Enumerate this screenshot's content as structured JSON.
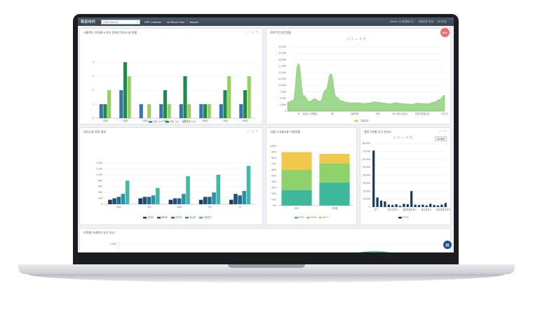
{
  "topbar": {
    "logo": "하모아키",
    "search_placeholder": "Data Board",
    "nav": [
      "APP Creation",
      "All Block Size",
      "Report"
    ],
    "user": "Admin 님 환영합니다.",
    "links": [
      "비밀번호 변경",
      "로그아웃"
    ]
  },
  "all_button": "ALL",
  "panels": {
    "p1": {
      "title": "서울북도 자치별 노약자 장애인 편의시설 현황"
    },
    "p2": {
      "title": "2017년 방문생활"
    },
    "p3": {
      "title": "대기오염 측정 결과"
    },
    "p4": {
      "title": "서울시 대표교통 이용현황"
    },
    "p5": {
      "title": "행정구역별 인구 분포도",
      "year": "2018년"
    },
    "p6": {
      "title": "지역별 미세먼지 농도 비교"
    }
  },
  "colors": {
    "blue": "#3b74ad",
    "dark_green": "#1f8a4c",
    "light_green": "#95d160",
    "area_green": "#8fd07a",
    "navy": "#1c3a5c",
    "yellow": "#f0c94c",
    "teal": "#3fb79b"
  },
  "chart_data": [
    {
      "type": "bar",
      "categories": [
        "1층안",
        "2층안",
        "3층안",
        "4층안",
        "5층안",
        "6층안",
        "7층안",
        "8층안"
      ],
      "series": [
        {
          "name": "유형 1(1)",
          "values": [
            1,
            2,
            1,
            1,
            1,
            1,
            1,
            1
          ]
        },
        {
          "name": "유형 1(2)",
          "values": [
            1,
            4,
            0,
            2,
            3,
            1,
            2,
            2
          ]
        },
        {
          "name": "유형 1(3)",
          "values": [
            2,
            3,
            1,
            1,
            1,
            1,
            3,
            3
          ]
        }
      ],
      "ylim": [
        0,
        4
      ],
      "yticks": [
        "0",
        "1",
        "2",
        "3",
        "4"
      ]
    },
    {
      "type": "area",
      "x": [
        "",
        "허",
        "양남지 1에점방",
        "",
        "해",
        "",
        "계대약부",
        "",
        "고령",
        "",
        "도도 종도신장대",
        "",
        "보호지전통식당",
        "",
        "기타 신"
      ],
      "values": [
        3500,
        4200,
        18500,
        6000,
        3800,
        4800,
        3900,
        8200,
        14500,
        5500,
        4000,
        3400,
        3200,
        3300,
        3000,
        3200,
        3600,
        3400,
        3100,
        2900,
        3300,
        3000,
        2800,
        2700,
        3100,
        3000,
        2900,
        3500,
        4500,
        6200
      ],
      "ylim": [
        0,
        25000
      ],
      "yticks": [
        "0",
        "2,500",
        "5,000",
        "7,500",
        "10,000",
        "12,500",
        "15,000",
        "17,500",
        "20,000",
        "22,500",
        "25,000"
      ],
      "legend": "월별주요"
    },
    {
      "type": "bar",
      "categories": [
        "Mon",
        "Tue",
        "Wed",
        "Thu",
        "Fri"
      ],
      "series": [
        {
          "name": "강원계",
          "values": [
            150,
            200,
            150,
            150,
            150
          ]
        },
        {
          "name": "충청계",
          "values": [
            200,
            250,
            200,
            250,
            350
          ]
        },
        {
          "name": "전라계",
          "values": [
            250,
            250,
            200,
            250,
            300
          ]
        },
        {
          "name": "경상계",
          "values": [
            350,
            300,
            350,
            400,
            450
          ]
        },
        {
          "name": "서울경기",
          "values": [
            800,
            550,
            950,
            1000,
            1300
          ]
        }
      ],
      "ylim": [
        0,
        1400
      ],
      "yticks": [
        "0",
        "200",
        "400",
        "600",
        "800",
        "1,000",
        "1,200",
        "1,400"
      ]
    },
    {
      "type": "bar",
      "categories": [
        "버스",
        "지하철"
      ],
      "series": [
        {
          "name": "2015",
          "values": [
            26,
            39
          ]
        },
        {
          "name": "2016",
          "values": [
            34,
            32
          ]
        },
        {
          "name": "2017",
          "values": [
            30,
            16
          ]
        }
      ],
      "ylim": [
        0,
        100
      ],
      "yticks": [
        "0%",
        "10%",
        "20%",
        "30%",
        "40%",
        "50%",
        "60%",
        "70%",
        "80%",
        "90%",
        "100%"
      ]
    },
    {
      "type": "bar",
      "categories": [
        "인구",
        "",
        "인천 광역시",
        "",
        "세종특별자치시",
        "",
        "울산광역시",
        "",
        "제주특별자치도"
      ],
      "values": [
        71000,
        12000,
        8000,
        7000,
        3000,
        2500,
        3500,
        1500,
        4000,
        3500,
        20000,
        3000,
        2500,
        3000,
        2000,
        4000,
        2500,
        2000,
        3000,
        5000
      ],
      "ylim": [
        0,
        80000
      ],
      "yticks": [
        "0",
        "10,000",
        "20,000",
        "30,000",
        "40,000",
        "50,000",
        "60,000",
        "70,000",
        "80,000"
      ],
      "legend": "인구수"
    },
    {
      "type": "line",
      "yticks": [
        "3,000"
      ]
    }
  ]
}
